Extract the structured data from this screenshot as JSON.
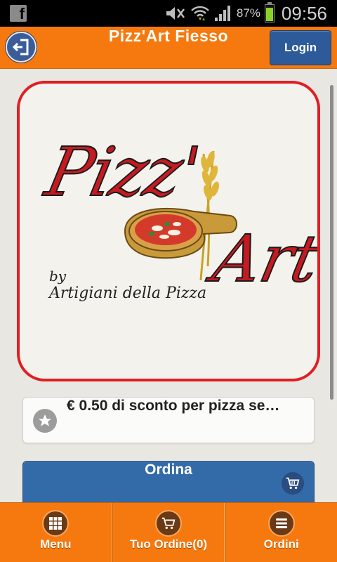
{
  "status_bar": {
    "battery_percent": "87%",
    "time": "09:56",
    "icons": [
      "facebook-icon",
      "mute-icon",
      "wifi-icon",
      "signal-icon",
      "battery-icon"
    ]
  },
  "header": {
    "title": "Pizz'Art Fiesso",
    "login_label": "Login",
    "back_icon": "exit-icon"
  },
  "logo": {
    "text_pizz": "Pizz'",
    "text_art": "Art",
    "text_by": "by",
    "text_sub": "Artigiani della Pizza",
    "colors": {
      "border": "#e01e24",
      "lettering": "#c41a21"
    }
  },
  "promo": {
    "icon": "star-icon",
    "text": "€ 0.50 di sconto per pizza se…"
  },
  "order_button": {
    "label": "Ordina",
    "icon": "cart-icon"
  },
  "bottom_nav": {
    "items": [
      {
        "label": "Menu",
        "icon": "grid-icon"
      },
      {
        "label": "Tuo Ordine(0)",
        "icon": "cart-icon"
      },
      {
        "label": "Ordini",
        "icon": "list-icon"
      }
    ]
  },
  "colors": {
    "accent": "#f5790e",
    "primary_button": "#336aa8",
    "background": "#e9e7e2"
  }
}
